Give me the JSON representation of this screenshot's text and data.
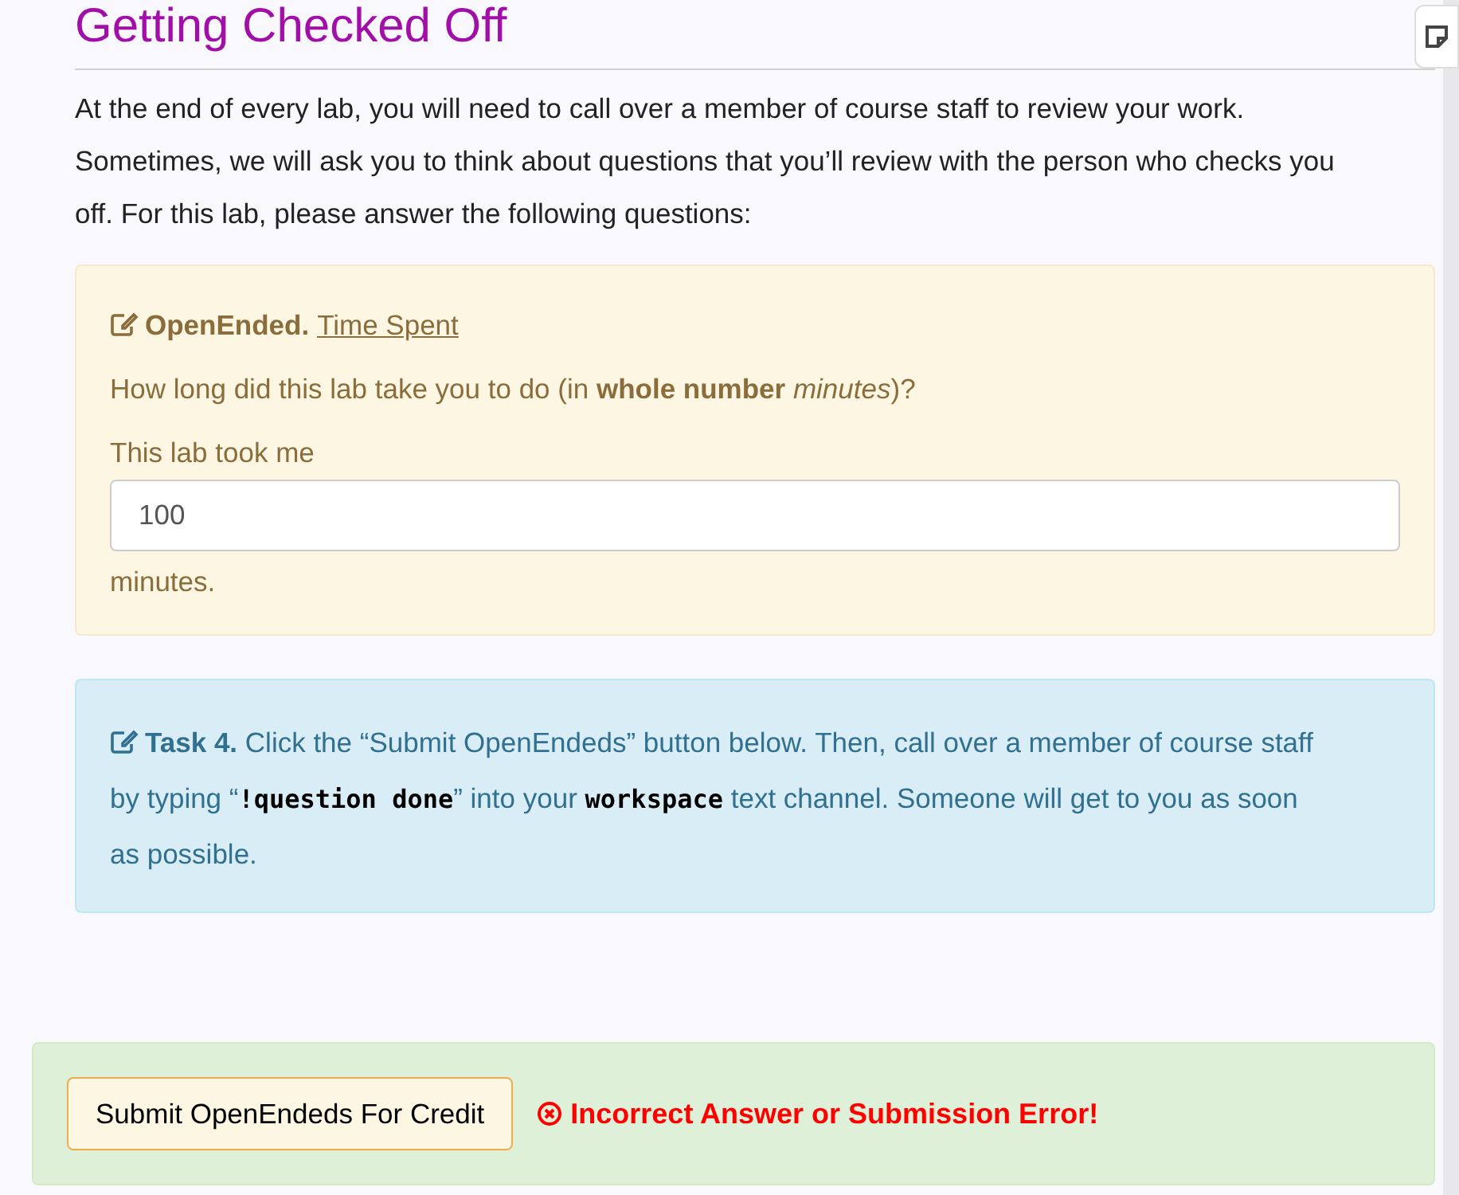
{
  "heading": "Getting Checked Off",
  "intro": [
    "At the end of every lab, you will need to call over a member of course staff to review your work.",
    "Sometimes, we will ask you to think about questions that you’ll review with the person who checks you off. For this lab, please answer the following questions:"
  ],
  "question": {
    "label": "OpenEnded.",
    "title": "Time Spent",
    "prompt": "How long did this lab take you to do (in **whole number** *minutes*)?",
    "before": "This lab took me",
    "value": "100",
    "after": "minutes."
  },
  "task": {
    "label": "Task 4.",
    "parts": [
      {
        "kind": "text",
        "text": "Click the “Submit OpenEndeds” button below. Then, call over a member of course staff by typing “"
      },
      {
        "kind": "code",
        "text": "!question done"
      },
      {
        "kind": "text",
        "text": "” into your "
      },
      {
        "kind": "code",
        "text": "workspace"
      },
      {
        "kind": "text",
        "text": " text channel. Someone will get to you as soon as possible."
      }
    ]
  },
  "submit": {
    "button": "Submit OpenEndeds For Credit",
    "error": true,
    "message": "Incorrect Answer or Submission Error!"
  }
}
